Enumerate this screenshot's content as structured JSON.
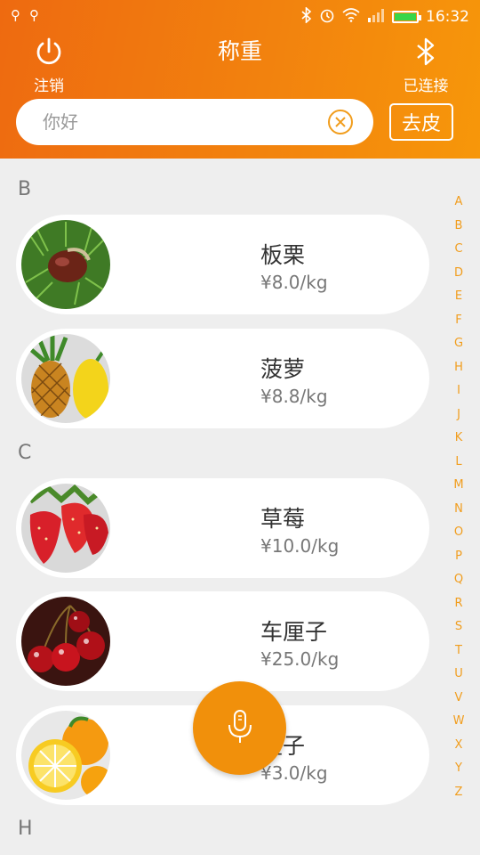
{
  "status_bar": {
    "time": "16:32",
    "left_icons": [
      "usb-icon",
      "usb-icon"
    ],
    "right_icons": [
      "bluetooth-icon",
      "alarm-icon",
      "wifi-icon",
      "signal-icon",
      "battery-icon"
    ]
  },
  "header": {
    "title": "称重",
    "logout_label": "注销",
    "bluetooth_label": "已连接",
    "search_placeholder": "你好",
    "tare_label": "去皮",
    "accent_color": "#f08a0e"
  },
  "list": {
    "sections": [
      {
        "letter": "B",
        "items": [
          {
            "name": "板栗",
            "price": "¥8.0/kg",
            "image": "chestnut"
          },
          {
            "name": "菠萝",
            "price": "¥8.8/kg",
            "image": "pineapple"
          }
        ]
      },
      {
        "letter": "C",
        "items": [
          {
            "name": "草莓",
            "price": "¥10.0/kg",
            "image": "strawberry"
          },
          {
            "name": "车厘子",
            "price": "¥25.0/kg",
            "image": "cherry"
          },
          {
            "name": "橙子",
            "price": "¥3.0/kg",
            "image": "orange"
          }
        ]
      },
      {
        "letter": "H",
        "items": []
      }
    ]
  },
  "index_letters": [
    "A",
    "B",
    "C",
    "D",
    "E",
    "F",
    "G",
    "H",
    "I",
    "J",
    "K",
    "L",
    "M",
    "N",
    "O",
    "P",
    "Q",
    "R",
    "S",
    "T",
    "U",
    "V",
    "W",
    "X",
    "Y",
    "Z"
  ],
  "fab": {
    "icon": "microphone-icon"
  }
}
